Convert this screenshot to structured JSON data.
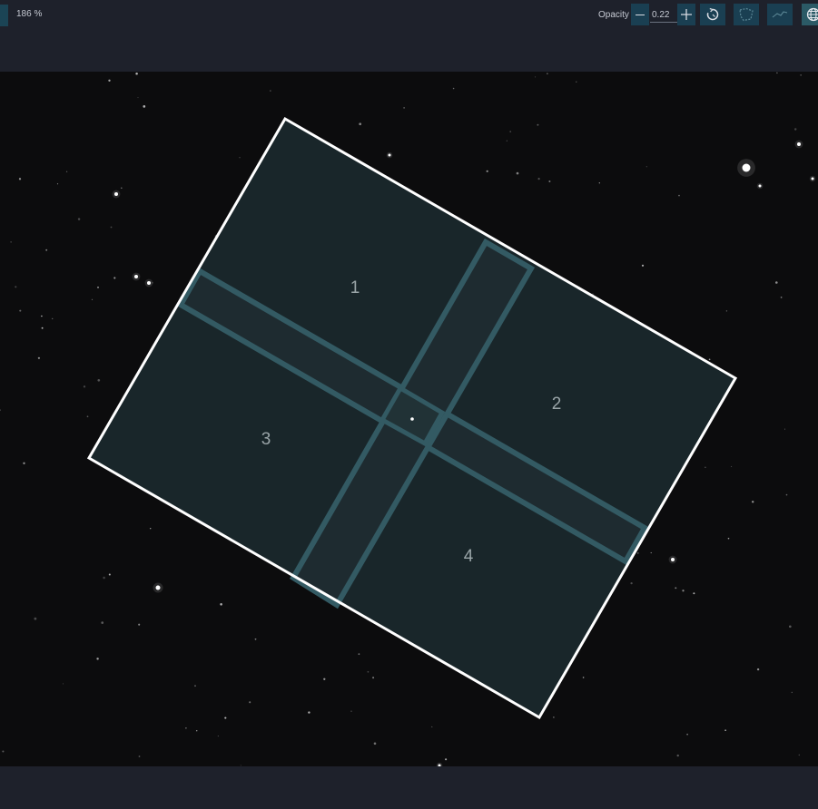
{
  "toolbar": {
    "zoom_level": "186 %",
    "opacity_label": "Opacity",
    "opacity_value": "0.22"
  },
  "icons": {
    "opacity_decrease": "minus-icon",
    "opacity_increase": "plus-icon",
    "rotate": "rotate-icon",
    "constellation_boundaries": "dashed-shape-icon",
    "constellation_lines": "constellation-lines-icon",
    "grid": "globe-icon"
  },
  "overlay": {
    "detector_labels": [
      "1",
      "2",
      "3",
      "4"
    ]
  },
  "colors": {
    "toolbar_bg": "#1e212b",
    "sky_bg": "#0c0c0d",
    "button_bg": "#1a3f52",
    "active_button_bg": "#2b5a66",
    "footprint_fill": "#19262a",
    "footprint_band": "#335a63",
    "footprint_gap": "#1e2b30",
    "footprint_outline": "#ffffff"
  }
}
